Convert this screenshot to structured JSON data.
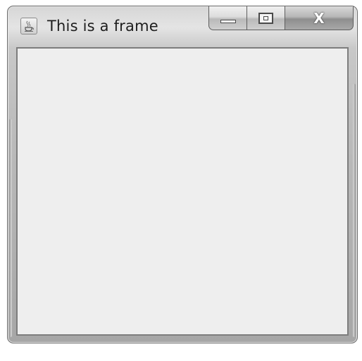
{
  "window": {
    "title": "This is a frame",
    "app_icon": "java-cup-icon",
    "controls": {
      "minimize_icon": "minimize-icon",
      "maximize_icon": "maximize-icon",
      "close_label": "X"
    }
  },
  "colors": {
    "client_background": "#eeeeee",
    "frame_border": "#6a6a6a"
  }
}
